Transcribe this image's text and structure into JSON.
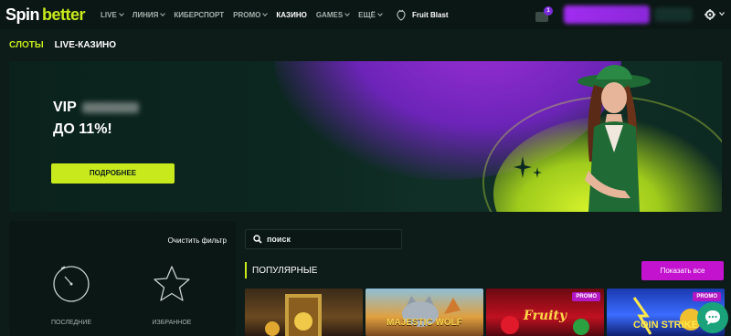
{
  "brand": {
    "spin": "Spin",
    "better": "better"
  },
  "nav": [
    {
      "label": "LIVE",
      "dropdown": true,
      "active": false
    },
    {
      "label": "ЛИНИЯ",
      "dropdown": true,
      "active": false
    },
    {
      "label": "КИБЕРСПОРТ",
      "dropdown": false,
      "active": false
    },
    {
      "label": "PROMO",
      "dropdown": true,
      "active": false
    },
    {
      "label": "КАЗИНО",
      "dropdown": false,
      "active": true
    },
    {
      "label": "GAMES",
      "dropdown": true,
      "active": false
    },
    {
      "label": "ЕЩЁ",
      "dropdown": true,
      "active": false
    }
  ],
  "fruit_blast": "Fruit Blast",
  "gift_count": "1",
  "tabs": {
    "slots": "СЛОТЫ",
    "live_casino": "LIVE-КАЗИНО"
  },
  "banner": {
    "vip": "VIP",
    "percent": "ДО 11%!",
    "button": "ПОДРОБНЕЕ"
  },
  "filter": {
    "clear": "Очистить фильтр",
    "recent": "ПОСЛЕДНИЕ",
    "favorites": "ИЗБРАННОЕ"
  },
  "search": {
    "placeholder": "поиск"
  },
  "popular": {
    "title": "ПОПУЛЯРНЫЕ",
    "show_all": "Показать все"
  },
  "games": [
    {
      "title": "",
      "promo": ""
    },
    {
      "title": "MAJESTIC WOLF",
      "promo": ""
    },
    {
      "title": "Fruity",
      "promo": "PROMO"
    },
    {
      "title": "COIN STRIKE",
      "promo": "PROMO"
    }
  ],
  "colors": {
    "accent": "#c8ea1d",
    "promo": "#c313cf",
    "bg": "#0e1c19"
  }
}
